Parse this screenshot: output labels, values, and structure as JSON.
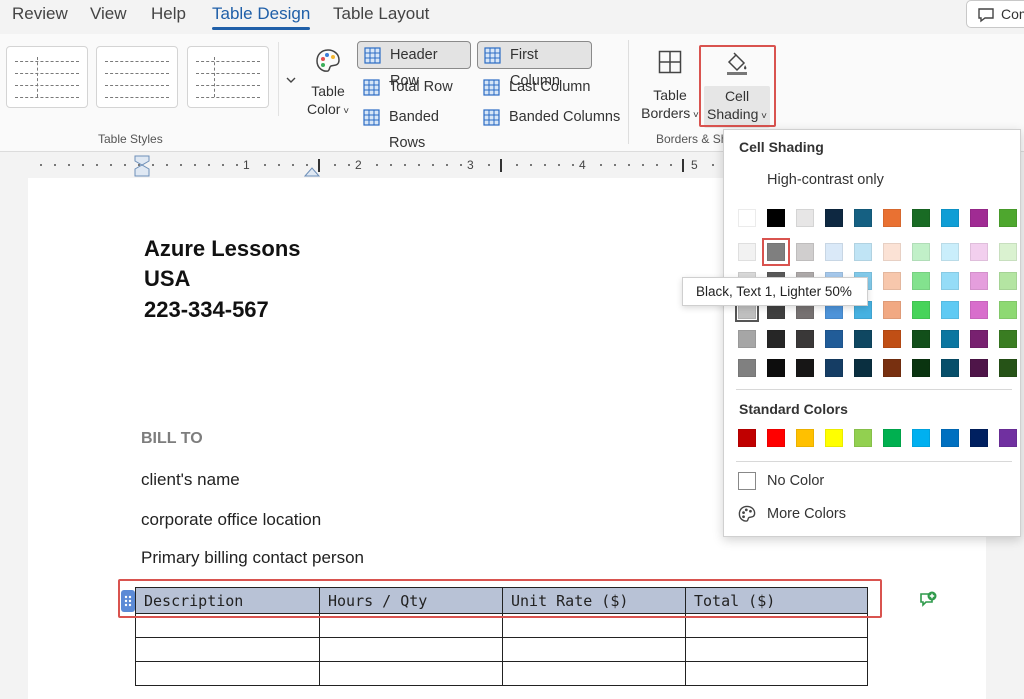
{
  "tabs": [
    {
      "label": "Review",
      "active": false
    },
    {
      "label": "View",
      "active": false
    },
    {
      "label": "Help",
      "active": false
    },
    {
      "label": "Table Design",
      "active": true
    },
    {
      "label": "Table Layout",
      "active": false
    }
  ],
  "comments_button": {
    "label": "Com"
  },
  "ribbon": {
    "table_styles_label": "Table Styles",
    "table_color": {
      "line1": "Table",
      "line2": "Color"
    },
    "options": {
      "header_row": {
        "label": "Header Row",
        "checked": true
      },
      "total_row": {
        "label": "Total Row",
        "checked": false
      },
      "banded_rows": {
        "label": "Banded Rows",
        "checked": false
      },
      "first_column": {
        "label": "First Column",
        "checked": true
      },
      "last_column": {
        "label": "Last Column",
        "checked": false
      },
      "banded_columns": {
        "label": "Banded Columns",
        "checked": false
      }
    },
    "table_borders": {
      "line1": "Table",
      "line2": "Borders"
    },
    "cell_shading": {
      "line1": "Cell",
      "line2": "Shading"
    },
    "borders_group_label": "Borders & Sh"
  },
  "ruler": {
    "numbers": [
      "1",
      "2",
      "3",
      "4",
      "5"
    ]
  },
  "document": {
    "company_name": "Azure Lessons",
    "company_country": "USA",
    "company_phone": "223-334-567",
    "bill_to": "BILL TO",
    "client_name": "client's name",
    "office_location": "corporate office location",
    "billing_contact": "Primary billing contact person",
    "table": {
      "headers": [
        "Description",
        "Hours / Qty",
        "Unit Rate ($)",
        "Total ($)"
      ],
      "empty_rows": 3,
      "header_shading": "#b8c2d6"
    }
  },
  "cell_shading_panel": {
    "title": "Cell Shading",
    "high_contrast": "High-contrast only",
    "theme_colors_top": [
      "#ffffff",
      "#000000",
      "#e7e6e6",
      "#0e2841",
      "#156082",
      "#e97132",
      "#196b24",
      "#0f9ed5",
      "#a02b93",
      "#4ea72e"
    ],
    "theme_colors_shades": [
      [
        "#f2f2f2",
        "#7f7f7f",
        "#d0cece",
        "#dae9f8",
        "#c0e4f5",
        "#fbe2d5",
        "#c1f0c8",
        "#caeefb",
        "#f2cfee",
        "#daf2d0"
      ],
      [
        "#d9d9d9",
        "#595959",
        "#aeaaaa",
        "#a6c9ec",
        "#83cbeb",
        "#f7c7ac",
        "#83e28e",
        "#95dcf7",
        "#e59edd",
        "#b4e5a2"
      ],
      [
        "#bfbfbf",
        "#404040",
        "#767171",
        "#4d93d9",
        "#46b1e1",
        "#f1a983",
        "#47d359",
        "#60caf3",
        "#d86ecc",
        "#8ed973"
      ],
      [
        "#a6a6a6",
        "#262626",
        "#3a3838",
        "#215c98",
        "#0f4761",
        "#c04f15",
        "#124f1a",
        "#0b76a0",
        "#782170",
        "#3a7d22"
      ],
      [
        "#808080",
        "#0d0d0d",
        "#171616",
        "#153d64",
        "#0a2f40",
        "#783010",
        "#0a3410",
        "#074f6a",
        "#4f1549",
        "#265317"
      ]
    ],
    "standard_colors_label": "Standard Colors",
    "standard_colors": [
      "#c00000",
      "#ff0000",
      "#ffc000",
      "#ffff00",
      "#92d050",
      "#00b050",
      "#00b0f0",
      "#0070c0",
      "#002060",
      "#7030a0"
    ],
    "no_color": "No Color",
    "more_colors": "More Colors",
    "hovered_swatch": "#7f7f7f"
  },
  "tooltip": "Black, Text 1, Lighter 50%",
  "icons": [
    "comment-icon",
    "table-color-icon",
    "grid-icon",
    "table-borders-icon",
    "paint-bucket-icon",
    "palette-icon",
    "add-comment-icon",
    "table-move-handle-icon",
    "chevron-down-icon"
  ]
}
